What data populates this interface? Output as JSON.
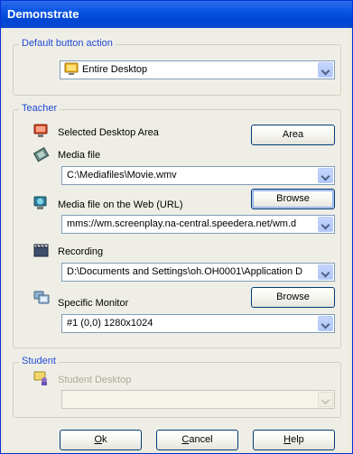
{
  "window": {
    "title": "Demonstrate"
  },
  "default_action": {
    "group_title": "Default button action",
    "selected": "Entire Desktop"
  },
  "teacher": {
    "group_title": "Teacher",
    "selected_area_label": "Selected Desktop Area",
    "area_button": "Area",
    "media_file_label": "Media file",
    "media_file_value": "C:\\Mediafiles\\Movie.wmv",
    "browse_button": "Browse",
    "web_label": "Media file on the Web (URL)",
    "web_value": "mms://wm.screenplay.na-central.speedera.net/wm.d",
    "recording_label": "Recording",
    "recording_value": "D:\\Documents and Settings\\oh.OH0001\\Application D",
    "monitor_browse_button": "Browse",
    "specific_monitor_label": "Specific Monitor",
    "monitor_value": "#1 (0,0) 1280x1024"
  },
  "student": {
    "group_title": "Student",
    "desktop_label": "Student Desktop",
    "desktop_value": ""
  },
  "footer": {
    "ok": {
      "accel": "O",
      "rest": "k"
    },
    "cancel": {
      "accel": "C",
      "rest": "ancel"
    },
    "help": {
      "accel": "H",
      "rest": "elp"
    }
  },
  "colors": {
    "titlebar": "#0a54e3",
    "group_title": "#1f4bd6",
    "disabled_text": "#adaa9c"
  }
}
